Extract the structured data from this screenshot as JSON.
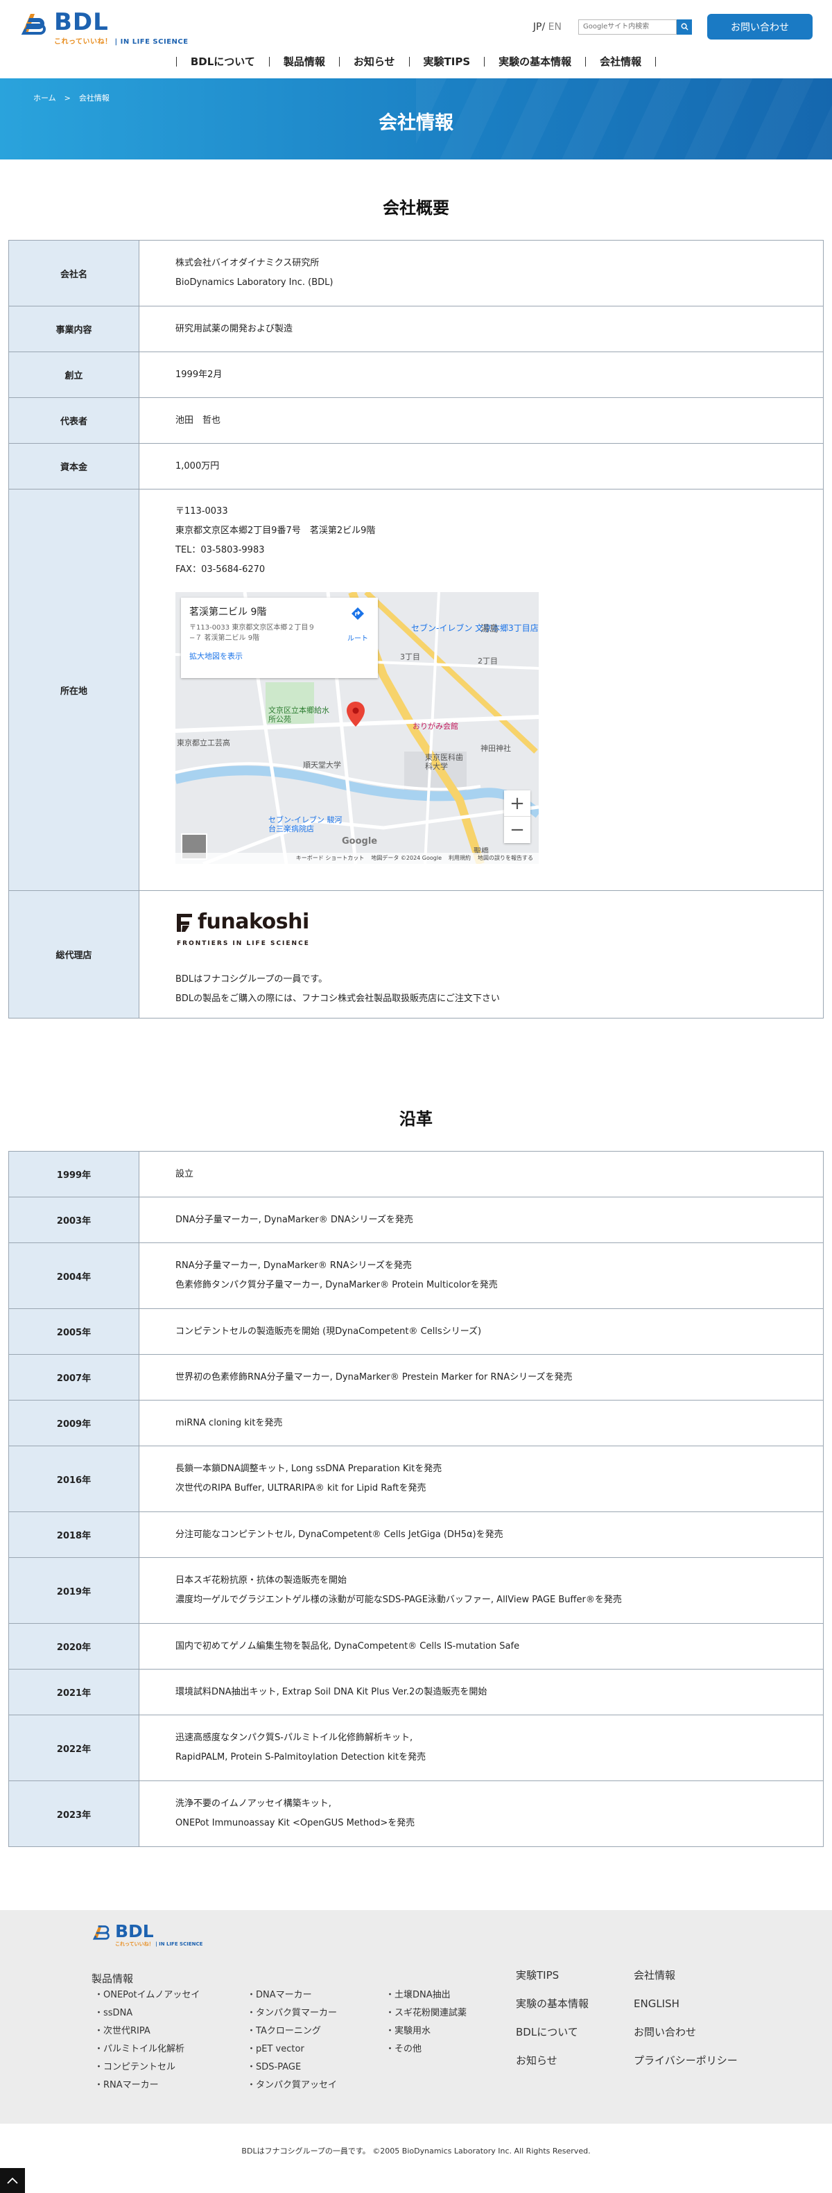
{
  "header": {
    "logo_text": "BDL",
    "logo_tag_a": "これっていいね！",
    "logo_tag_b": "IN LIFE SCIENCE",
    "lang_jp": "JP",
    "lang_sep": "/ ",
    "lang_en": "EN",
    "search_placeholder": "Googleサイト内検索",
    "contact_label": "お問い合わせ",
    "nav": [
      "BDLについて",
      "製品情報",
      "お知らせ",
      "実験TIPS",
      "実験の基本情報",
      "会社情報"
    ]
  },
  "hero": {
    "breadcrumb_home": "ホーム",
    "breadcrumb_sep": ">",
    "breadcrumb_current": "会社情報",
    "title": "会社情報"
  },
  "overview": {
    "title": "会社概要",
    "rows": [
      {
        "label": "会社名",
        "lines": [
          "株式会社バイオダイナミクス研究所",
          "BioDynamics Laboratory Inc. (BDL)"
        ]
      },
      {
        "label": "事業内容",
        "lines": [
          "研究用試薬の開発および製造"
        ]
      },
      {
        "label": "創立",
        "lines": [
          "1999年2月"
        ]
      },
      {
        "label": "代表者",
        "lines": [
          "池田　哲也"
        ]
      },
      {
        "label": "資本金",
        "lines": [
          "1,000万円"
        ]
      }
    ],
    "address": {
      "label": "所在地",
      "lines": [
        "〒113-0033",
        "東京都文京区本郷2丁目9番7号　茗渓第2ビル9階",
        "TEL：03-5803-9983",
        "FAX：03-5684-6270"
      ],
      "map": {
        "place": "茗渓第二ビル 9階",
        "place_addr": "〒113-0033 東京都文京区本郷２丁目９−７ 茗渓第二ビル 9階",
        "enlarge": "拡大地図を表示",
        "route": "ルート",
        "labels": [
          "湯島",
          "3丁目",
          "2丁目",
          "セブン-イレブン 文京本郷3丁目店",
          "文京区立本郷給水所公苑",
          "順天堂大学",
          "おりがみ会館",
          "東京医科歯科大学",
          "神田神社",
          "東京都立工芸高",
          "聖橋",
          "セブン-イレブン 駿河台三楽病院店"
        ],
        "zoom_in": "+",
        "zoom_out": "−",
        "google": "Google",
        "shortcuts": "キーボード ショートカット",
        "map_data": "地図データ ©2024 Google",
        "terms": "利用規約",
        "report": "地図の誤りを報告する"
      }
    },
    "agent": {
      "label": "総代理店",
      "brand": "funakoshi",
      "brand_sub": "FRONTIERS IN LIFE SCIENCE",
      "lines": [
        "BDLはフナコシグループの一員です。",
        "BDLの製品をご購入の際には、フナコシ株式会社製品取扱販売店にご注文下さい"
      ]
    }
  },
  "history": {
    "title": "沿革",
    "rows": [
      {
        "year": "1999年",
        "lines": [
          "設立"
        ]
      },
      {
        "year": "2003年",
        "lines": [
          "DNA分子量マーカー, DynaMarker® DNAシリーズを発売"
        ]
      },
      {
        "year": "2004年",
        "lines": [
          "RNA分子量マーカー, DynaMarker® RNAシリーズを発売",
          "色素修飾タンパク質分子量マーカー, DynaMarker® Protein Multicolorを発売"
        ]
      },
      {
        "year": "2005年",
        "lines": [
          "コンピテントセルの製造販売を開始 (現DynaCompetent® Cellsシリーズ)"
        ]
      },
      {
        "year": "2007年",
        "lines": [
          "世界初の色素修飾RNA分子量マーカー, DynaMarker® Prestein Marker for RNAシリーズを発売"
        ]
      },
      {
        "year": "2009年",
        "lines": [
          "miRNA cloning kitを発売"
        ]
      },
      {
        "year": "2016年",
        "lines": [
          "長鎖一本鎖DNA調整キット, Long ssDNA Preparation Kitを発売",
          "次世代のRIPA Buffer, ULTRARIPA® kit for Lipid Raftを発売"
        ]
      },
      {
        "year": "2018年",
        "lines": [
          "分注可能なコンピテントセル, DynaCompetent® Cells JetGiga (DH5α)を発売"
        ]
      },
      {
        "year": "2019年",
        "lines": [
          "日本スギ花粉抗原・抗体の製造販売を開始",
          "濃度均一ゲルでグラジエントゲル様の泳動が可能なSDS-PAGE泳動バッファー, AllView PAGE Buffer®を発売"
        ]
      },
      {
        "year": "2020年",
        "lines": [
          "国内で初めてゲノム編集生物を製品化, DynaCompetent® Cells IS-mutation Safe"
        ]
      },
      {
        "year": "2021年",
        "lines": [
          "環境試料DNA抽出キット, Extrap Soil DNA Kit Plus Ver.2の製造販売を開始"
        ]
      },
      {
        "year": "2022年",
        "lines": [
          "迅速高感度なタンパク質S-パルミトイル化修飾解析キット,",
          "RapidPALM, Protein S-Palmitoylation Detection kitを発売"
        ]
      },
      {
        "year": "2023年",
        "lines": [
          "洗浄不要のイムノアッセイ構築キット,",
          "ONEPot Immunoassay Kit <OpenGUS Method>を発売"
        ]
      }
    ]
  },
  "footer": {
    "logo_text": "BDL",
    "logo_tag_a": "これっていいね！",
    "logo_tag_b": "IN LIFE SCIENCE",
    "products_heading": "製品情報",
    "col1": [
      "ONEPotイムノアッセイ",
      "ssDNA",
      "次世代RIPA",
      "パルミトイル化解析",
      "コンピテントセル",
      "RNAマーカー"
    ],
    "col2": [
      "DNAマーカー",
      "タンパク質マーカー",
      "TAクローニング",
      "pET vector",
      "SDS-PAGE",
      "タンパク質アッセイ"
    ],
    "col3": [
      "土壌DNA抽出",
      "スギ花粉関連試薬",
      "実験用水",
      "その他"
    ],
    "links_a": [
      "実験TIPS",
      "実験の基本情報",
      "BDLについて",
      "お知らせ"
    ],
    "links_b": [
      "会社情報",
      "ENGLISH",
      "お問い合わせ",
      "プライバシーポリシー"
    ],
    "copyright": "BDLはフナコシグループの一員です。 ©2005 BioDynamics Laboratory Inc. All Rights Reserved."
  },
  "colors": {
    "brand_blue": "#1d62b0",
    "accent_blue": "#1a7ac4",
    "accent_orange": "#e88d1f",
    "table_header_bg": "#dfeaf4",
    "footer_bg": "#ececec"
  }
}
